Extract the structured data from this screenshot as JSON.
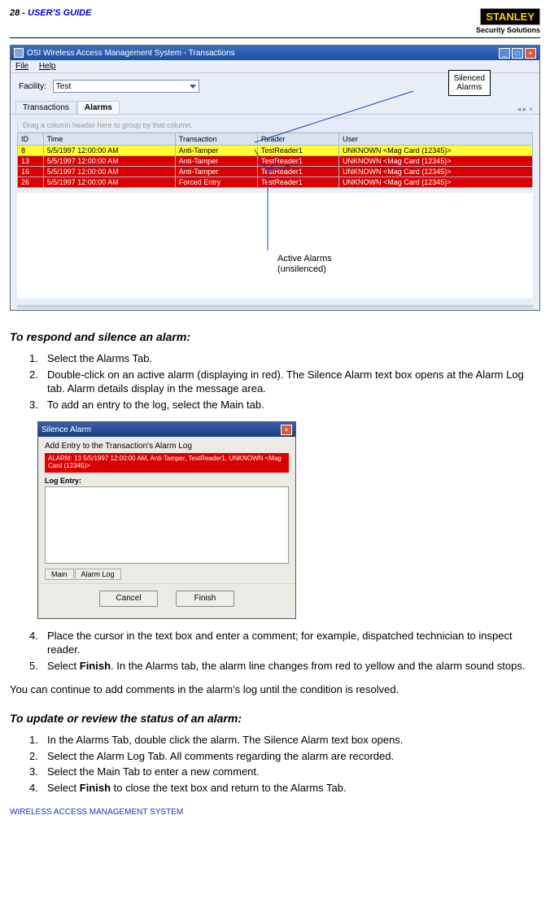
{
  "header": {
    "page_label_prefix": "28 - ",
    "page_label_blue": "USER'S GUIDE",
    "logo_text": "STANLEY",
    "logo_sub": "Security Solutions"
  },
  "app": {
    "title": "OSI Wireless Access Management System - Transactions",
    "menu": {
      "file": "File",
      "help": "Help"
    },
    "facility_label": "Facility:",
    "facility_value": "Test",
    "tabs": {
      "transactions": "Transactions",
      "alarms": "Alarms"
    },
    "group_hint": "Drag a column header here to group by that column.",
    "columns": {
      "id": "ID",
      "time": "Time",
      "transaction": "Transaction",
      "reader": "Reader",
      "user": "User"
    },
    "rows": [
      {
        "id": "8",
        "time": "5/5/1997 12:00:00 AM",
        "txn": "Anti-Tamper",
        "reader": "TestReader1",
        "user": "UNKNOWN <Mag Card (12345)>",
        "cls": "yellow"
      },
      {
        "id": "13",
        "time": "5/5/1997 12:00:00 AM",
        "txn": "Anti-Tamper",
        "reader": "TestReader1",
        "user": "UNKNOWN <Mag Card (12345)>",
        "cls": "red"
      },
      {
        "id": "16",
        "time": "5/5/1997 12:00:00 AM",
        "txn": "Anti-Tamper",
        "reader": "TestReader1",
        "user": "UNKNOWN <Mag Card (12345)>",
        "cls": "red"
      },
      {
        "id": "26",
        "time": "5/5/1997 12:00:00 AM",
        "txn": "Forced Entry",
        "reader": "TestReader1",
        "user": "UNKNOWN <Mag Card (12345)>",
        "cls": "red"
      }
    ],
    "callout_silenced": "Silenced\nAlarms",
    "callout_active": "Active Alarms\n(unsilenced)"
  },
  "section1": {
    "title": "To respond and silence an alarm:",
    "steps": [
      "Select the Alarms Tab.",
      "Double-click on an active alarm (displaying in red).   The Silence Alarm text box opens at the Alarm Log tab. Alarm details display in the message area.",
      "To add an entry to the log, select the Main tab."
    ]
  },
  "dialog": {
    "title": "Silence Alarm",
    "msg": "Add Entry to the Transaction's Alarm Log",
    "alarm_text": "ALARM: 13  5/5/1997 12:00:00 AM, Anti-Tamper, TestReader1, UNKNOWN <Mag Card (12345)>",
    "log_label": "Log Entry:",
    "tab_main": "Main",
    "tab_log": "Alarm Log",
    "btn_cancel": "Cancel",
    "btn_finish": "Finish"
  },
  "section1b": {
    "step4": "Place the cursor in the text box and enter a comment; for example, dispatched technician to inspect reader.",
    "step5_pre": "Select ",
    "step5_bold": "Finish",
    "step5_post": ".   In the Alarms tab, the alarm line changes from red to yellow and the alarm sound stops.",
    "after": "You can continue to add comments in the alarm's log until the condition is resolved."
  },
  "section2": {
    "title": "To update or review the status of an alarm:",
    "steps": [
      "In the Alarms Tab, double click the alarm.   The Silence Alarm text box opens.",
      "Select the Alarm Log Tab.   All comments regarding the alarm are recorded.",
      "Select the Main Tab to enter a new comment."
    ],
    "step4_pre": "Select ",
    "step4_bold": "Finish",
    "step4_post": " to close the text box and return to the Alarms Tab."
  },
  "footer": "WIRELESS ACCESS MANAGEMENT SYSTEM"
}
